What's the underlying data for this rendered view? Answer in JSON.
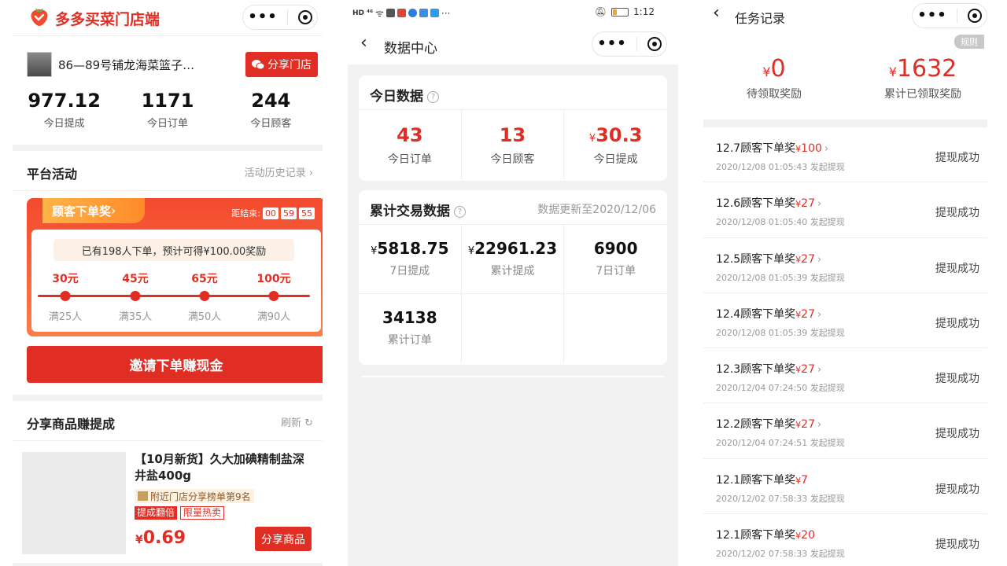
{
  "panel1": {
    "brand": "多多买菜门店端",
    "shop_name": "86—89号铺龙海菜篮子…",
    "share_shop_label": "分享门店",
    "stats": [
      {
        "value": "977.12",
        "label": "今日提成"
      },
      {
        "value": "1171",
        "label": "今日订单"
      },
      {
        "value": "244",
        "label": "今日顾客"
      }
    ],
    "activity_title": "平台活动",
    "activity_history": "活动历史记录",
    "promo": {
      "tag": "顾客下单奖",
      "countdown_label": "距结束:",
      "countdown": [
        "00",
        "59",
        "55"
      ],
      "note": "已有198人下单，预计可得¥100.00奖励",
      "tiers": [
        {
          "amount": "30元",
          "condition": "满25人"
        },
        {
          "amount": "45元",
          "condition": "满35人"
        },
        {
          "amount": "65元",
          "condition": "满50人"
        },
        {
          "amount": "100元",
          "condition": "满90人"
        }
      ]
    },
    "invite_button": "邀请下单赚现金",
    "share_section_title": "分享商品赚提成",
    "refresh_label": "刷新",
    "product": {
      "title": "【10月新货】久大加碘精制盐深井盐400g",
      "rank": "附近门店分享榜单第9名",
      "tags": [
        "提成翻倍",
        "限量热卖"
      ],
      "currency": "¥",
      "price": "0.69",
      "share_button": "分享商品"
    }
  },
  "panel2": {
    "status_time": "1:12",
    "status_signal": "HD ⁴⁶",
    "title": "数据中心",
    "today_title": "今日数据",
    "today": [
      {
        "value": "43",
        "label": "今日订单"
      },
      {
        "value": "13",
        "label": "今日顾客"
      },
      {
        "currency": "¥",
        "value": "30.3",
        "label": "今日提成"
      }
    ],
    "cumulative_title": "累计交易数据",
    "updated": "数据更新至2020/12/06",
    "cumulative": [
      {
        "currency": "¥",
        "value": "5818.75",
        "label": "7日提成"
      },
      {
        "currency": "¥",
        "value": "22961.23",
        "label": "累计提成"
      },
      {
        "value": "6900",
        "label": "7日订单"
      },
      {
        "value": "34138",
        "label": "累计订单"
      }
    ]
  },
  "panel3": {
    "title": "任务记录",
    "rules": "规则",
    "pending": {
      "currency": "¥",
      "value": "0",
      "label": "待领取奖励"
    },
    "claimed": {
      "currency": "¥",
      "value": "1632",
      "label": "累计已领取奖励"
    },
    "tasks": [
      {
        "name": "12.7顾客下单奖",
        "currency": "¥",
        "amount": "100",
        "time": "2020/12/08 01:05:43 发起提现",
        "status": "提现成功"
      },
      {
        "name": "12.6顾客下单奖",
        "currency": "¥",
        "amount": "27",
        "time": "2020/12/08 01:05:40 发起提现",
        "status": "提现成功"
      },
      {
        "name": "12.5顾客下单奖",
        "currency": "¥",
        "amount": "27",
        "time": "2020/12/08 01:05:39 发起提现",
        "status": "提现成功"
      },
      {
        "name": "12.4顾客下单奖",
        "currency": "¥",
        "amount": "27",
        "time": "2020/12/08 01:05:39 发起提现",
        "status": "提现成功"
      },
      {
        "name": "12.3顾客下单奖",
        "currency": "¥",
        "amount": "27",
        "time": "2020/12/04 07:24:50 发起提现",
        "status": "提现成功"
      },
      {
        "name": "12.2顾客下单奖",
        "currency": "¥",
        "amount": "27",
        "time": "2020/12/04 07:24:51 发起提现",
        "status": "提现成功"
      },
      {
        "name": "12.1顾客下单奖",
        "currency": "¥",
        "amount": "7",
        "time": "2020/12/02 07:58:33 发起提现",
        "status": "提现成功"
      },
      {
        "name": "12.1顾客下单奖",
        "currency": "¥",
        "amount": "20",
        "time": "2020/12/02 07:58:33 发起提现",
        "status": "提现成功"
      }
    ]
  },
  "colors": {
    "accent": "#e02e24",
    "promo_gradient_start": "#f44a2f",
    "promo_gradient_end": "#fa7d4a"
  }
}
